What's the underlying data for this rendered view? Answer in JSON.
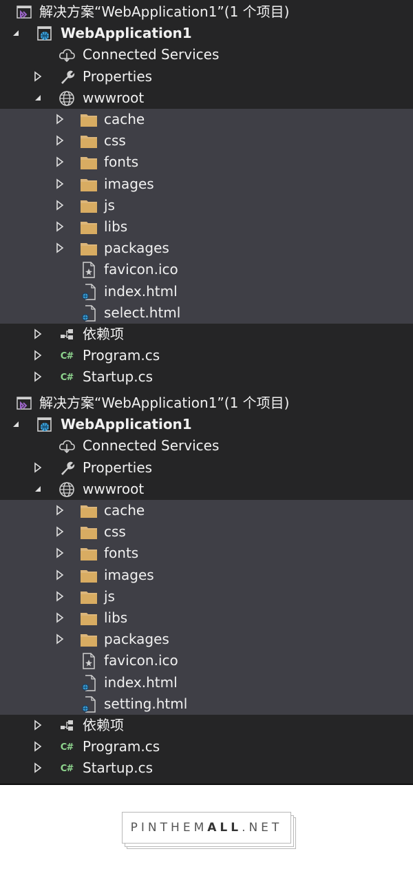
{
  "colors": {
    "panel_bg": "#252526",
    "highlight_bg": "#3f3f46",
    "text": "#f1f1f1",
    "folder": "#dcb67a",
    "csharp": "#8fd68f",
    "vs_purple": "#9b65c8",
    "globe_blue": "#3fa7e0"
  },
  "trees": [
    {
      "solution_label": "解决方案“WebApplication1”(1 个项目)",
      "project_label": "WebApplication1",
      "connected_services_label": "Connected Services",
      "properties_label": "Properties",
      "wwwroot_label": "wwwroot",
      "folders": [
        "cache",
        "css",
        "fonts",
        "images",
        "js",
        "libs",
        "packages"
      ],
      "files": [
        "favicon.ico",
        "index.html",
        "select.html"
      ],
      "dependencies_label": "依赖项",
      "program_label": "Program.cs",
      "startup_label": "Startup.cs"
    },
    {
      "solution_label": "解决方案“WebApplication1”(1 个项目)",
      "project_label": "WebApplication1",
      "connected_services_label": "Connected Services",
      "properties_label": "Properties",
      "wwwroot_label": "wwwroot",
      "folders": [
        "cache",
        "css",
        "fonts",
        "images",
        "js",
        "libs",
        "packages"
      ],
      "files": [
        "favicon.ico",
        "index.html",
        "setting.html"
      ],
      "dependencies_label": "依赖项",
      "program_label": "Program.cs",
      "startup_label": "Startup.cs"
    }
  ],
  "footer": {
    "logo_part1": "PIN",
    "logo_part2": "THEM",
    "logo_part3": "ALL",
    "logo_part4": ".NET"
  }
}
